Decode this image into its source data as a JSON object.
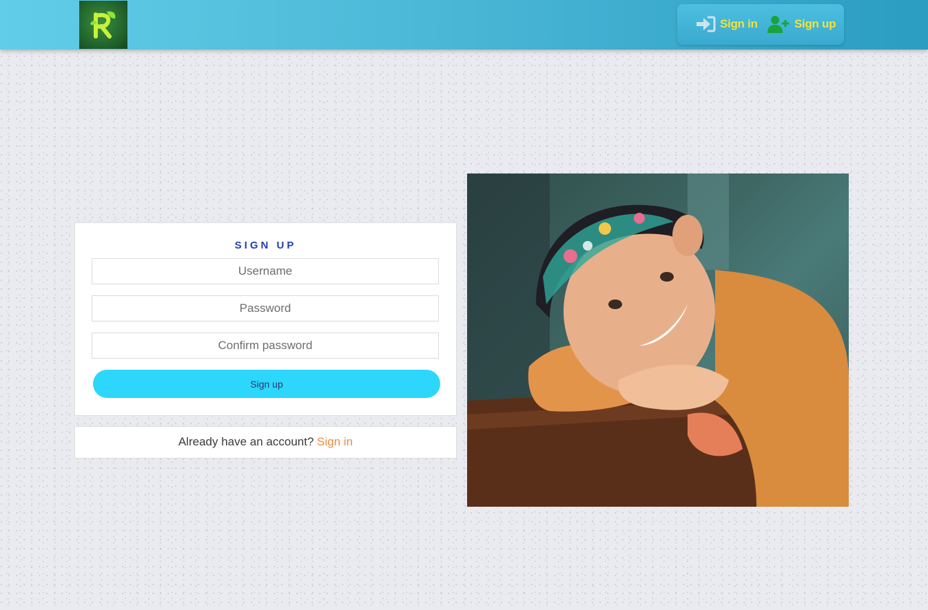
{
  "header": {
    "logo_alt": "R leaf logo",
    "signin_label": "Sign in",
    "signup_label": "Sign up"
  },
  "form": {
    "title": "SIGN UP",
    "username_placeholder": "Username",
    "password_placeholder": "Password",
    "confirm_placeholder": "Confirm password",
    "submit_label": "Sign up"
  },
  "account": {
    "prompt": "Already have an account? ",
    "link_label": "Sign in"
  },
  "colors": {
    "header_start": "#62cde8",
    "header_end": "#2a9dc1",
    "header_link": "#f3e23a",
    "signup_icon": "#1aa33a",
    "title": "#2240b0",
    "submit_bg": "#2dd6fb",
    "account_link": "#f08a3e"
  },
  "icons": {
    "signin": "sign-in-arrow-icon",
    "signup": "user-plus-icon"
  }
}
